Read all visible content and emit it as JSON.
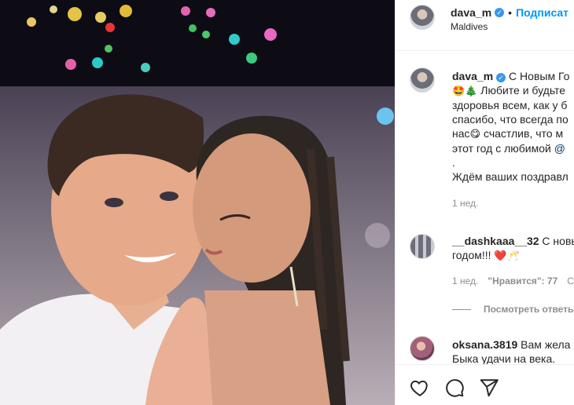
{
  "post": {
    "photo_alt": "",
    "author": {
      "username": "dava_m",
      "verified": true,
      "location": "Maldives",
      "follow_label": "Подписат",
      "separator": "•"
    },
    "caption": {
      "username": "dava_m",
      "line1": "С Новым Го",
      "line2_emoji": "🤩🎄",
      "line2": " Любите и будьте",
      "line3": "здоровья всем, как у б",
      "line4": "спасибо, что всегда по",
      "line5_a": "нас",
      "line5_emoji": "😋",
      "line5_b": " счастлив, что м",
      "line6_a": "этот год с любимой ",
      "line6_mention": "@",
      "line7": ".",
      "line8": "Ждём ваших поздравл",
      "time": "1 нед."
    },
    "comments": [
      {
        "username": "__dashkaaa__32",
        "text_a": " С новы",
        "text_b": "годом!!! ",
        "emoji": "❤️🥂",
        "time": "1 нед.",
        "likes": "\"Нравится\": 77",
        "reply_label": "С",
        "view_replies": "Посмотреть ответы"
      },
      {
        "username": "oksana.3819",
        "text_a": " Вам жела",
        "text_b": "Быка удачи на века."
      }
    ],
    "actions": {
      "like_icon": "heart-icon",
      "comment_icon": "comment-icon",
      "share_icon": "paper-plane-icon"
    },
    "colors": {
      "link_blue": "#0095f6",
      "verified_blue": "#3897f0",
      "muted_gray": "#8e8e8e",
      "heart_red": "#ed4956"
    }
  }
}
